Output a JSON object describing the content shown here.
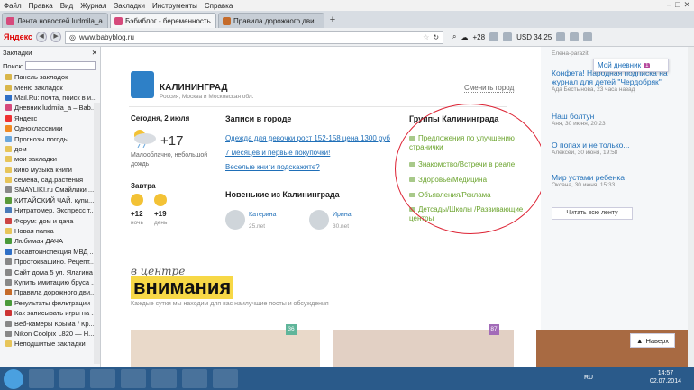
{
  "menu": [
    "Файл",
    "Правка",
    "Вид",
    "Журнал",
    "Закладки",
    "Инструменты",
    "Справка"
  ],
  "tabs": [
    {
      "label": "Лента новостей ludmila_a ...",
      "color": "#d64a7c",
      "active": false
    },
    {
      "label": "Бэбиблог - беременность...",
      "color": "#d64a7c",
      "active": true
    },
    {
      "label": "Правила дорожного дви...",
      "color": "#c56b2a",
      "active": false
    }
  ],
  "nav": {
    "brand": "Яндекс",
    "url": "www.babyblog.ru",
    "weather": "+28",
    "currency": "USD 34.25"
  },
  "sidebar": {
    "title": "Закладки",
    "search_label": "Поиск:",
    "items": [
      {
        "label": "Панель закладок",
        "color": "#d9b64a"
      },
      {
        "label": "Меню закладок",
        "color": "#d9b64a"
      },
      {
        "label": "Mail.Ru: почта, поиск в и...",
        "color": "#2f6fc6"
      },
      {
        "label": "Дневник ludmila_a – Bab...",
        "color": "#d64a7c"
      },
      {
        "label": "Яндекс",
        "color": "#e33"
      },
      {
        "label": "Одноклассники",
        "color": "#f08a24"
      },
      {
        "label": "Прогнозы погоды",
        "color": "#6aa7dd"
      },
      {
        "label": "дом",
        "color": "#e7c55a"
      },
      {
        "label": "мои закладки",
        "color": "#e7c55a"
      },
      {
        "label": "кино музыка книги",
        "color": "#e7c55a"
      },
      {
        "label": "семена, сад.растения",
        "color": "#e7c55a"
      },
      {
        "label": "SMAYLIKI.ru Смайлики ...",
        "color": "#888"
      },
      {
        "label": "КИТАЙСКИЙ ЧАЙ. купи...",
        "color": "#5a9a3a"
      },
      {
        "label": "Нитратомер. Экспресс т...",
        "color": "#4a7ab8"
      },
      {
        "label": "Форум: дом и дача",
        "color": "#c44"
      },
      {
        "label": "Новая папка",
        "color": "#e7c55a"
      },
      {
        "label": "Любимая ДАЧА",
        "color": "#4a9a3a"
      },
      {
        "label": "Госавтоинспекция МВД ...",
        "color": "#2f6fc6"
      },
      {
        "label": "Простоквашино. Рецепт...",
        "color": "#888"
      },
      {
        "label": "Сайт дома 5 ул. Ялагина ...",
        "color": "#888"
      },
      {
        "label": "Купить имитацию бруса ...",
        "color": "#888"
      },
      {
        "label": "Правила дорожного дви...",
        "color": "#c56b2a"
      },
      {
        "label": "Результаты фильтрации",
        "color": "#4a9a3a"
      },
      {
        "label": "Как записывать игры на ...",
        "color": "#c33"
      },
      {
        "label": "Веб-камеры Крыма / Кр...",
        "color": "#888"
      },
      {
        "label": "Nikon Coolpix L820 — Н...",
        "color": "#888"
      },
      {
        "label": "Неподшитые закладки",
        "color": "#e7c55a"
      }
    ]
  },
  "city": {
    "name": "КАЛИНИНГРАД",
    "sub": "Россия, Москва и Московская обл.",
    "change": "Сменить город"
  },
  "weather": {
    "today": "Сегодня, 2 июля",
    "temp": "+17",
    "desc": "Малооблачно, небольшой дождь",
    "tomorrow": "Завтра",
    "night_temp": "+12",
    "night_label": "ночь",
    "day_temp": "+19",
    "day_label": "день"
  },
  "records": {
    "title": "Записи в городе",
    "items": [
      "Одежда для девочки рост 152-158 цена 1300 руб",
      "7 месяцев и первые покупочки!",
      "Веселые книги подскажите?"
    ]
  },
  "newbies": {
    "title": "Новенькие из Калининграда",
    "users": [
      {
        "name": "Катерина",
        "date": "25.net"
      },
      {
        "name": "Ирина",
        "date": "30.net"
      }
    ]
  },
  "groups": {
    "title": "Группы Калининграда",
    "items": [
      "Предложения по улучшению странички",
      "Знакомство/Встречи в реале",
      "Здоровье/Медицина",
      "Объявления/Реклама",
      "Детсады/Школы /Развивающие центры"
    ]
  },
  "right": {
    "top_user": "Елена-parazit",
    "popup_label": "Мой дневник",
    "popup_count": "1",
    "blocks": [
      {
        "title": "Конфета! Народная подписка на журнал для детей \"Чердобряк\"",
        "meta": "Ада Бестынова, 23 часа назад"
      },
      {
        "title": "Наш болтун",
        "meta": "Аня, 30 июня, 20:23"
      },
      {
        "title": "О попах и не только...",
        "meta": "Алексей, 30 июня, 19:58"
      },
      {
        "title": "Мир устами ребенка",
        "meta": "Оксана, 30 июня, 15:33"
      }
    ],
    "all_button": "Читать всю ленту"
  },
  "focus": {
    "small": "в центре",
    "big": "внимания",
    "sub": "Каждые сутки мы находим для вас наилучшие посты и обсуждения",
    "badge1": "36",
    "badge2": "87",
    "back": "Наверх"
  },
  "system": {
    "lang": "RU",
    "time": "14:57",
    "date": "02.07.2014"
  }
}
